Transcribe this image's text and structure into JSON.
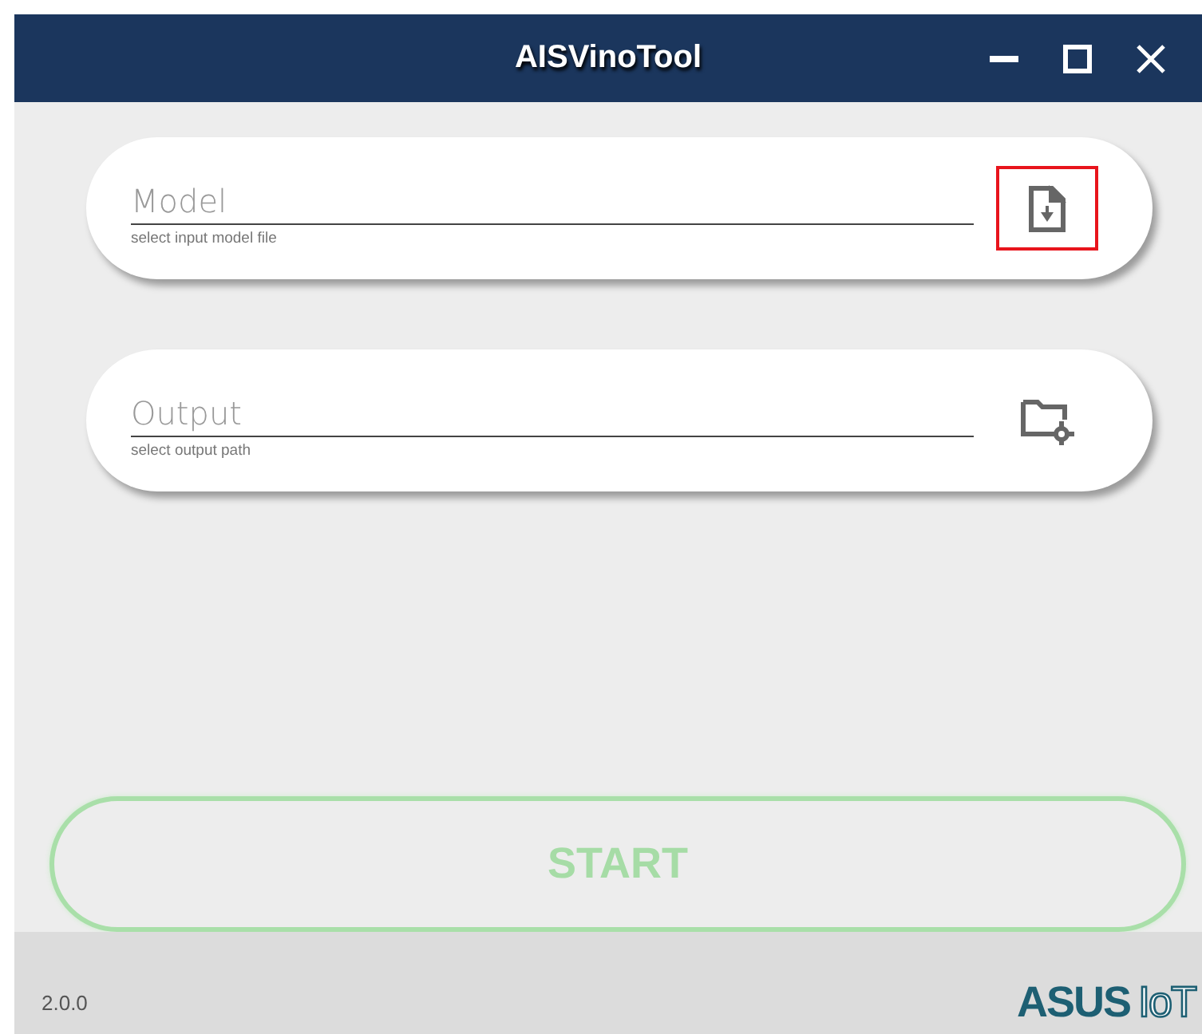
{
  "window": {
    "title": "AISVinoTool"
  },
  "fields": [
    {
      "kind": "file",
      "placeholder": "Model",
      "hint": "select input model file",
      "highlighted": true
    },
    {
      "kind": "folder",
      "placeholder": "Output",
      "hint": "select output path",
      "highlighted": false
    }
  ],
  "start_button": {
    "label": "START",
    "disabled": true
  },
  "footer": {
    "version": "2.0.0",
    "logo": [
      "ASUS",
      "IoT"
    ]
  }
}
